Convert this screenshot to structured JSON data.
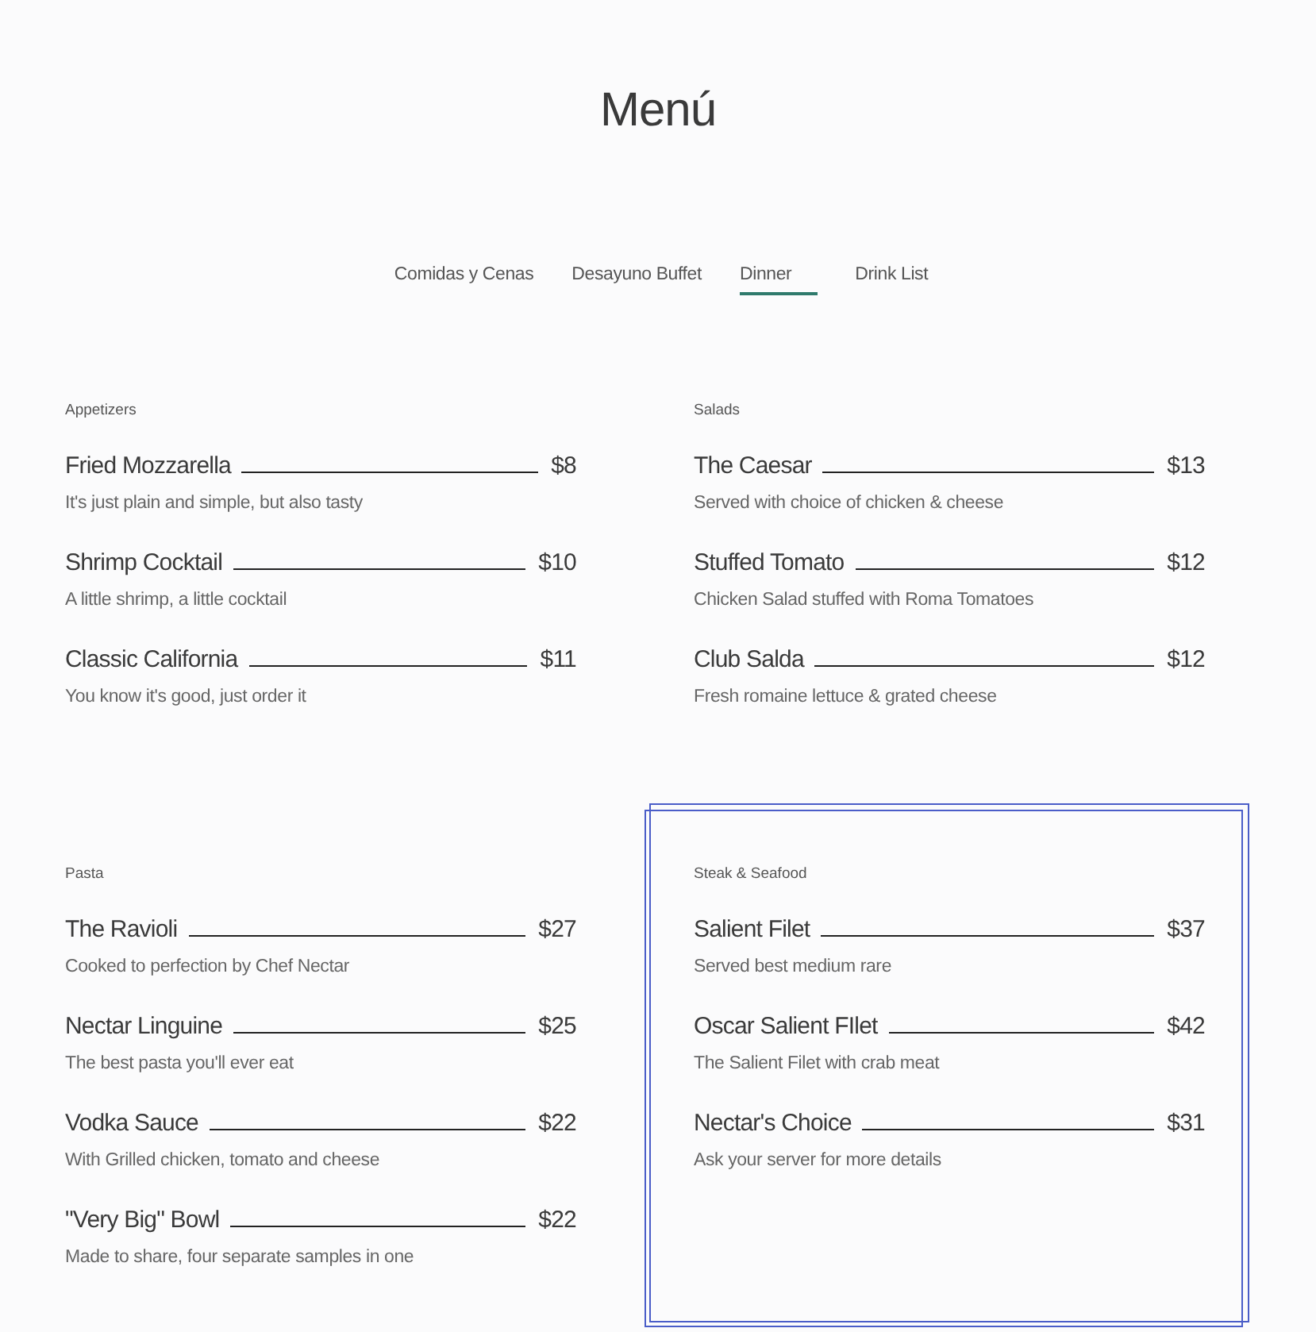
{
  "title": "Menú",
  "tabs": [
    {
      "label": "Comidas y Cenas",
      "selected": false
    },
    {
      "label": "Desayuno Buffet",
      "selected": false
    },
    {
      "label": "Dinner",
      "selected": true
    },
    {
      "label": "Drink List",
      "selected": false
    }
  ],
  "sections": [
    {
      "heading": "Appetizers",
      "highlighted": false,
      "items": [
        {
          "name": "Fried Mozzarella",
          "price": "$8",
          "description": "It's just plain and simple, but also tasty"
        },
        {
          "name": "Shrimp Cocktail",
          "price": "$10",
          "description": "A little shrimp, a little cocktail"
        },
        {
          "name": "Classic California",
          "price": "$11",
          "description": "You know it's good, just order it"
        }
      ]
    },
    {
      "heading": "Salads",
      "highlighted": false,
      "items": [
        {
          "name": "The Caesar",
          "price": "$13",
          "description": "Served with choice of chicken & cheese"
        },
        {
          "name": "Stuffed Tomato",
          "price": "$12",
          "description": "Chicken Salad stuffed with Roma Tomatoes"
        },
        {
          "name": "Club Salda",
          "price": "$12",
          "description": "Fresh romaine lettuce & grated cheese"
        }
      ]
    },
    {
      "heading": "Pasta",
      "highlighted": false,
      "items": [
        {
          "name": "The Ravioli",
          "price": "$27",
          "description": "Cooked to perfection by Chef Nectar"
        },
        {
          "name": "Nectar Linguine",
          "price": "$25",
          "description": "The best pasta you'll ever eat"
        },
        {
          "name": "Vodka Sauce",
          "price": "$22",
          "description": "With Grilled chicken, tomato and cheese"
        },
        {
          "name": "\"Very Big\" Bowl",
          "price": "$22",
          "description": "Made to share, four separate samples in one"
        }
      ]
    },
    {
      "heading": "Steak & Seafood",
      "highlighted": true,
      "items": [
        {
          "name": "Salient Filet",
          "price": "$37",
          "description": "Served best medium rare"
        },
        {
          "name": "Oscar Salient FIlet",
          "price": "$42",
          "description": "The Salient Filet with crab meat"
        },
        {
          "name": "Nectar's Choice",
          "price": "$31",
          "description": "Ask your server for more details"
        }
      ]
    }
  ]
}
